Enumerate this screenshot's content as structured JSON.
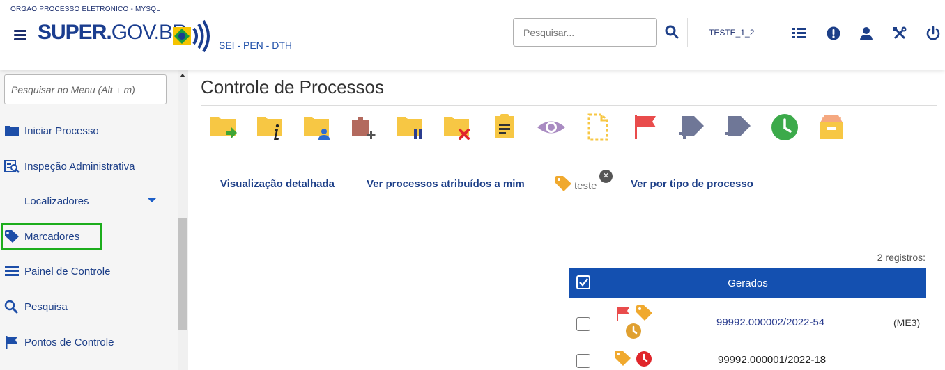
{
  "header": {
    "org": "ORGAO PROCESSO ELETRONICO - MYSQL",
    "logo_bold": "SUPER.",
    "logo_regular": "GOV.BR",
    "subtitle": "SEI - PEN - DTH",
    "search_placeholder": "Pesquisar...",
    "unit": "TESTE_1_2",
    "icons": [
      "menu-icon",
      "search-icon",
      "list-icon",
      "alert-icon",
      "user-icon",
      "tools-icon",
      "power-icon"
    ]
  },
  "sidebar": {
    "search_placeholder": "Pesquisar no Menu (Alt + m)",
    "items": [
      {
        "label": "Iniciar Processo",
        "icon": "folder-icon"
      },
      {
        "label": "Inspeção Administrativa",
        "icon": "inspection-icon"
      },
      {
        "label": "Localizadores",
        "icon": ""
      },
      {
        "label": "Marcadores",
        "icon": "tag-icon"
      },
      {
        "label": "Painel de Controle",
        "icon": "list-icon"
      },
      {
        "label": "Pesquisa",
        "icon": "search-icon"
      },
      {
        "label": "Pontos de Controle",
        "icon": "flag-icon"
      }
    ]
  },
  "main": {
    "title": "Controle de Processos",
    "links": {
      "detailed": "Visualização detalhada",
      "assigned": "Ver processos atribuídos a mim",
      "tag": "teste",
      "by_type": "Ver por tipo de processo"
    },
    "records": "2 registros:",
    "table": {
      "header": "Gerados",
      "rows": [
        {
          "number": "99992.000002/2022-54",
          "unit": "(ME3)",
          "color": "#2b3d8f"
        },
        {
          "number": "99992.000001/2022-18",
          "unit": "",
          "color": "#222222"
        }
      ]
    }
  },
  "colors": {
    "brand": "#1a3d8f",
    "table_header": "#1450b0",
    "highlight": "#1cad1c",
    "folder": "#f7c744",
    "tag": "#f0a92e"
  }
}
